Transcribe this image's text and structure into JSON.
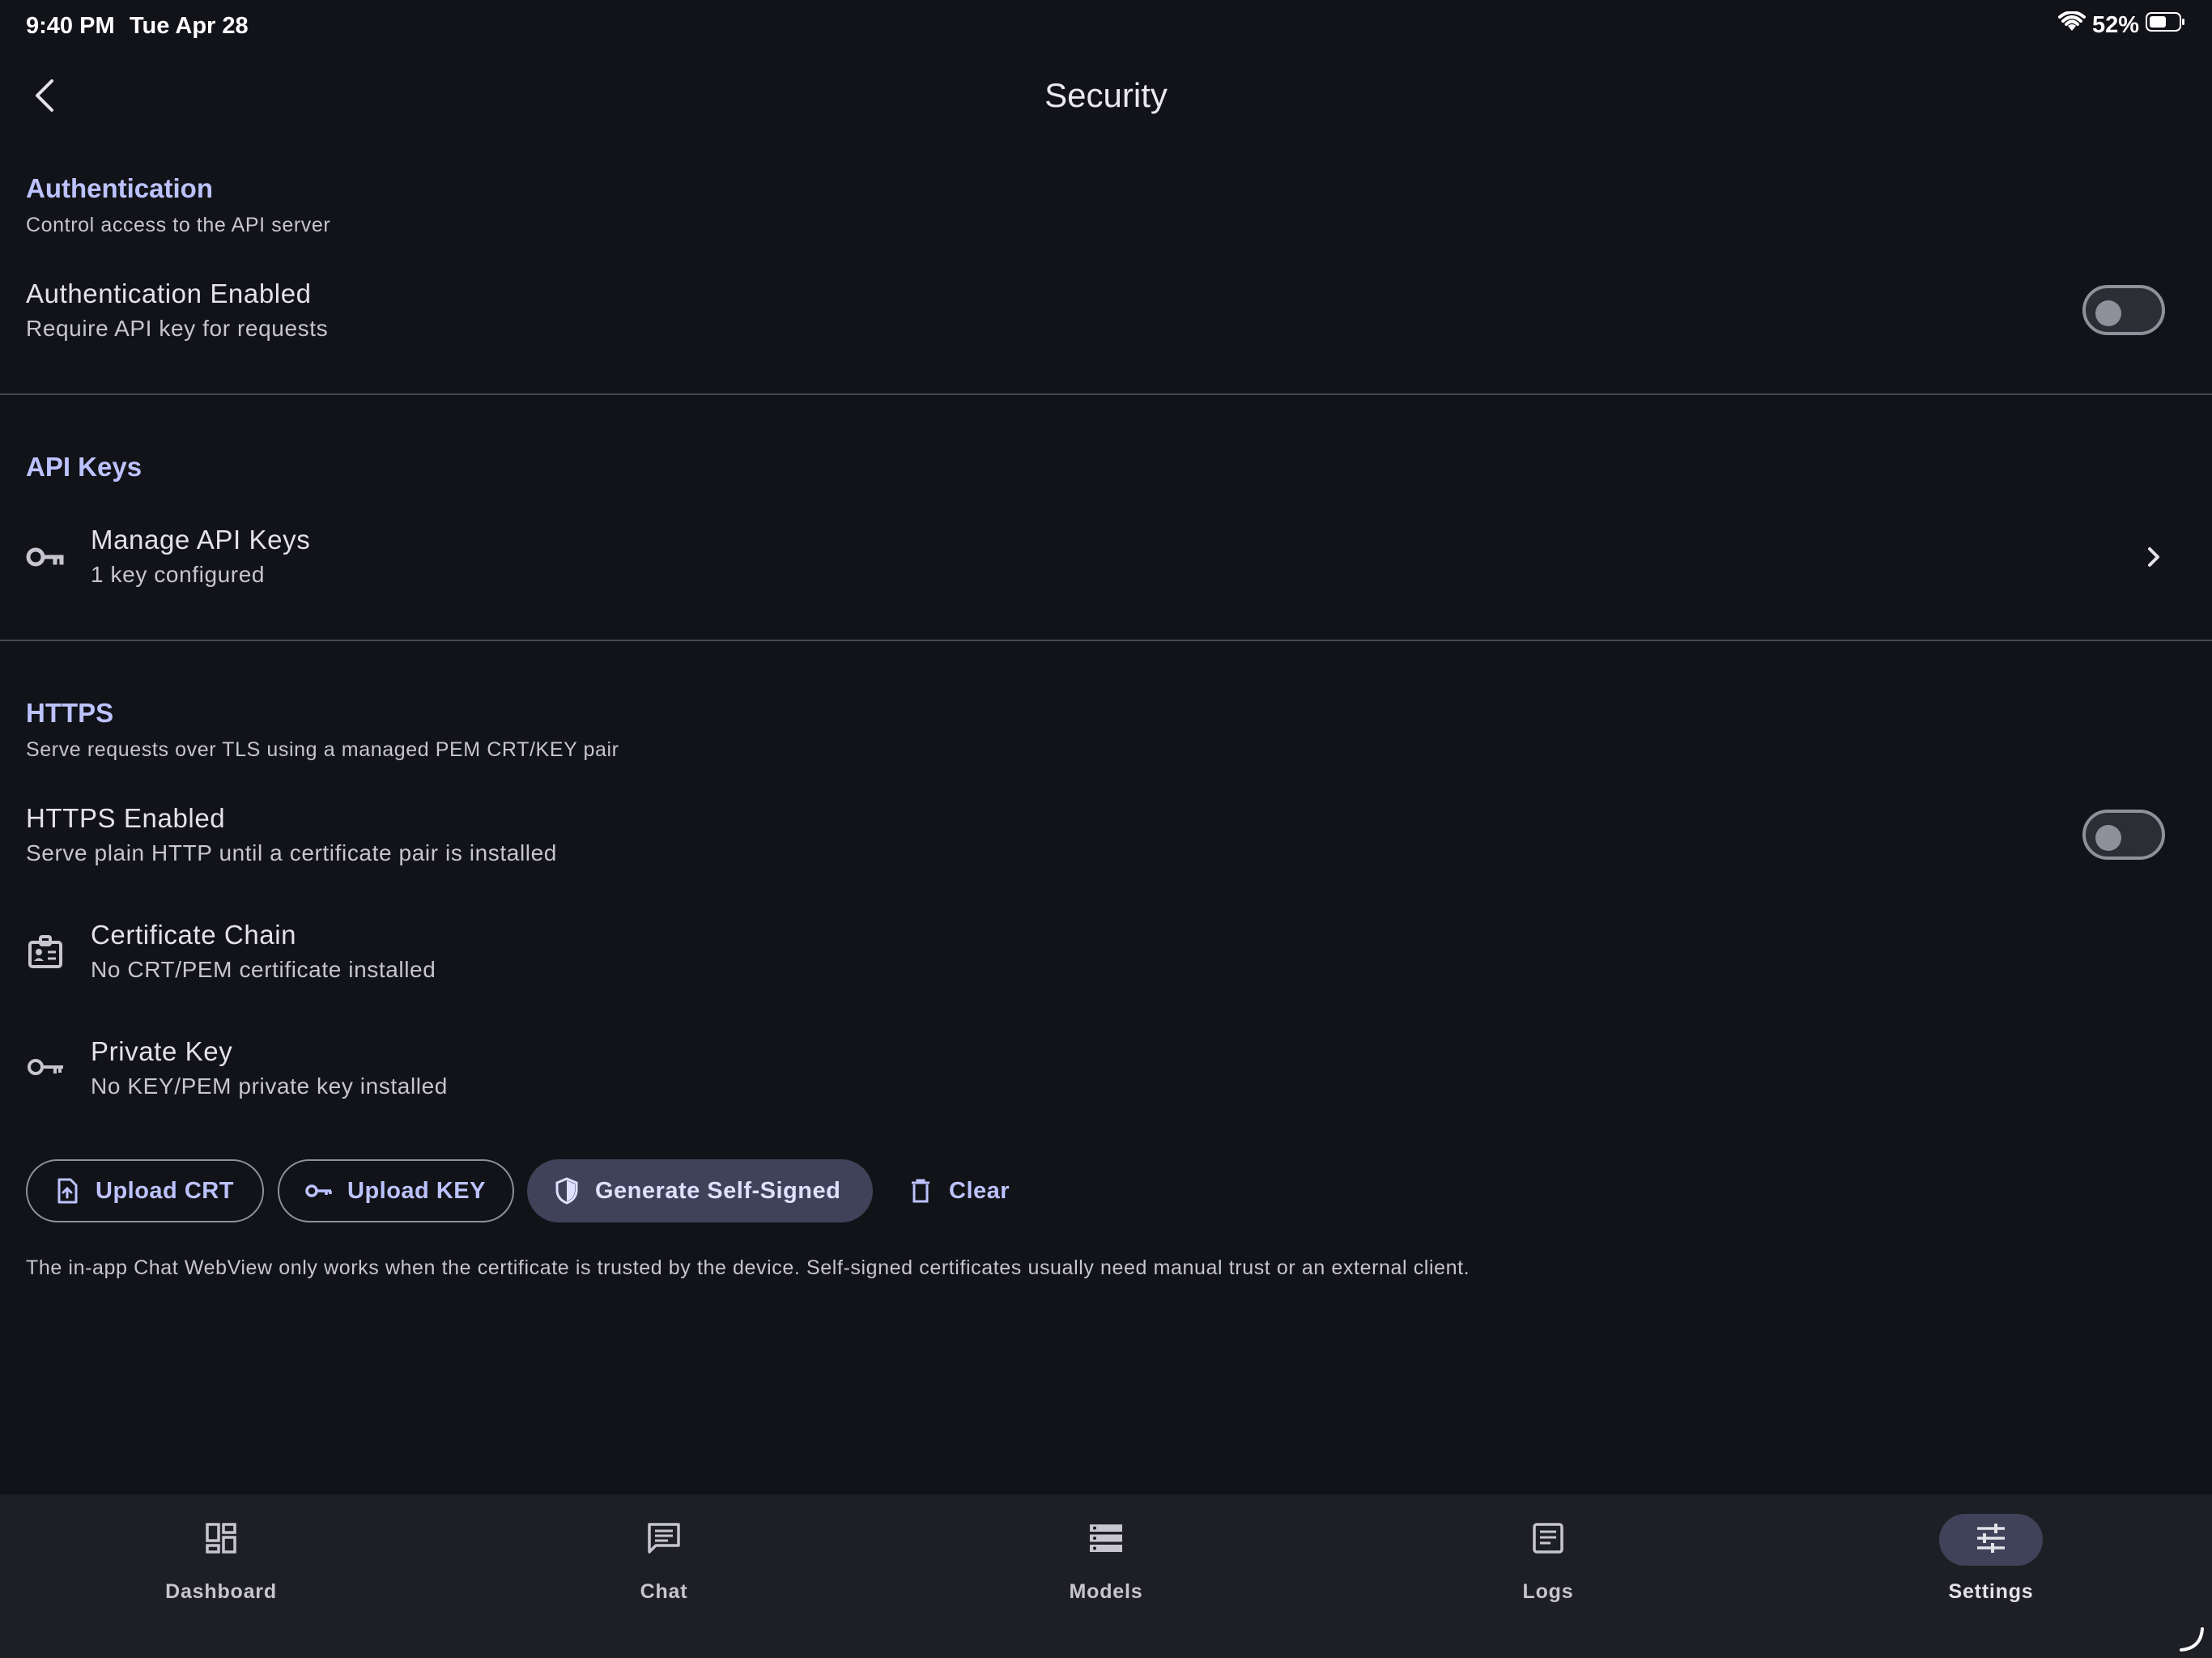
{
  "status_bar": {
    "time": "9:40 PM",
    "date": "Tue Apr 28",
    "battery_percent": "52%"
  },
  "header": {
    "title": "Security"
  },
  "authentication": {
    "title": "Authentication",
    "subtitle": "Control access to the API server",
    "enabled_row": {
      "title": "Authentication Enabled",
      "subtitle": "Require API key for requests",
      "toggle_on": false
    }
  },
  "api_keys": {
    "title": "API Keys",
    "manage_row": {
      "icon": "key-icon",
      "title": "Manage API Keys",
      "subtitle": "1 key configured"
    }
  },
  "https": {
    "title": "HTTPS",
    "subtitle": "Serve requests over TLS using a managed PEM CRT/KEY pair",
    "enabled_row": {
      "title": "HTTPS Enabled",
      "subtitle": "Serve plain HTTP until a certificate pair is installed",
      "toggle_on": false
    },
    "certificate_row": {
      "icon": "badge-icon",
      "title": "Certificate Chain",
      "subtitle": "No CRT/PEM certificate installed"
    },
    "private_key_row": {
      "icon": "key-icon",
      "title": "Private Key",
      "subtitle": "No KEY/PEM private key installed"
    },
    "buttons": {
      "upload_crt": "Upload CRT",
      "upload_key": "Upload KEY",
      "generate": "Generate Self-Signed",
      "clear": "Clear"
    },
    "footnote": "The in-app Chat WebView only works when the certificate is trusted by the device. Self-signed certificates usually need manual trust or an external client."
  },
  "nav": {
    "items": [
      {
        "label": "Dashboard",
        "icon": "dashboard-icon"
      },
      {
        "label": "Chat",
        "icon": "chat-icon"
      },
      {
        "label": "Models",
        "icon": "models-icon"
      },
      {
        "label": "Logs",
        "icon": "logs-icon"
      },
      {
        "label": "Settings",
        "icon": "settings-icon"
      }
    ],
    "active": "Settings"
  },
  "colors": {
    "background": "#121318",
    "accent": "#bcc2ff",
    "nav_background": "#1e1f25",
    "active_pill": "#3f4259"
  }
}
